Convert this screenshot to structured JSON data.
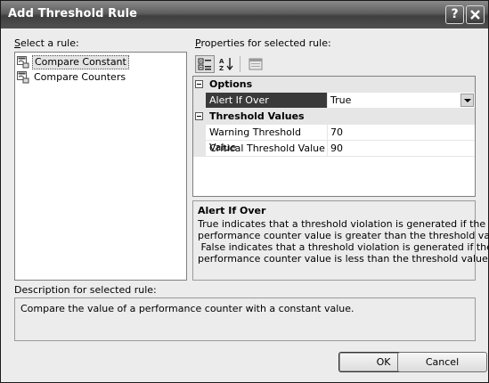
{
  "window": {
    "title": "Add Threshold Rule",
    "help_glyph": "?",
    "close_glyph": "X"
  },
  "rules": {
    "label_first": "S",
    "label_rest": "elect a rule:",
    "items": [
      {
        "label": "Compare Constant",
        "icon": "rule-icon",
        "selected": true
      },
      {
        "label": "Compare Counters",
        "icon": "rule-icon",
        "selected": false
      }
    ]
  },
  "properties": {
    "label_first": "P",
    "label_rest": "roperties for selected rule:",
    "toolbar": {
      "categorized": "categorized-view-icon",
      "alphabetical": "alphabetical-sort-icon",
      "property_pages": "property-pages-icon"
    },
    "categories": [
      {
        "name": "Options",
        "rows": [
          {
            "name": "Alert If Over",
            "value": "True",
            "dropdown": true
          }
        ]
      },
      {
        "name": "Threshold Values",
        "rows": [
          {
            "name": "Warning Threshold Value",
            "value": "70"
          },
          {
            "name": "Critical Threshold Value",
            "value": "90"
          }
        ]
      }
    ]
  },
  "help": {
    "title": "Alert If Over",
    "lines": [
      "True indicates that a threshold violation is generated if the",
      "performance counter value is greater than the threshold value.",
      " False indicates that a threshold violation is generated if the",
      "performance counter value is less than the threshold value."
    ]
  },
  "description": {
    "label": "Description for selected rule:",
    "text": "Compare the value of a performance counter with a constant value."
  },
  "buttons": {
    "ok": "OK",
    "cancel": "Cancel"
  }
}
